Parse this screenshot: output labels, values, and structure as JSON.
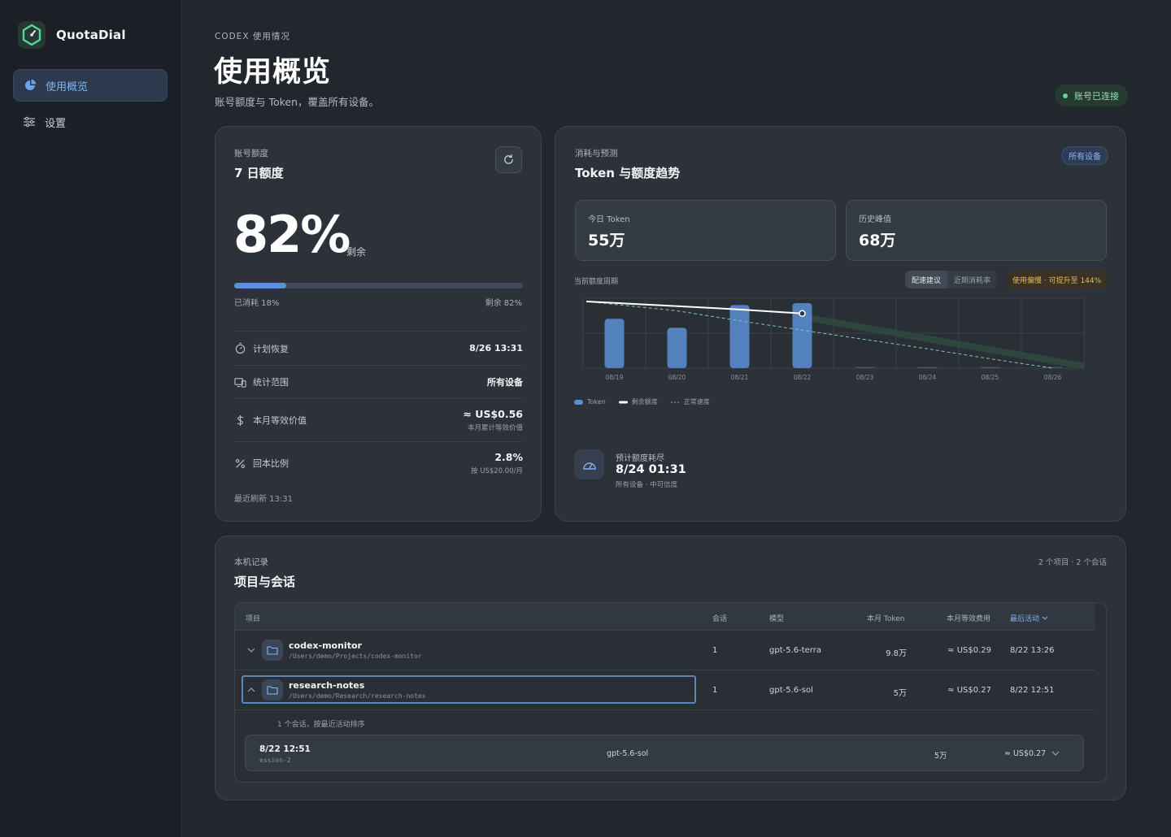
{
  "brand": {
    "name": "QuotaDial"
  },
  "sidebar": {
    "items": [
      {
        "label": "使用概览",
        "icon": "pie-chart-icon",
        "active": true
      },
      {
        "label": "设置",
        "icon": "sliders-icon",
        "active": false
      }
    ]
  },
  "header": {
    "eyebrow": "CODEX 使用情况",
    "title": "使用概览",
    "subtitle": "账号额度与 Token，覆盖所有设备。",
    "status_badge": "账号已连接"
  },
  "quota": {
    "eyebrow": "账号额度",
    "title": "7 日额度",
    "remaining_pct": "82%",
    "remaining_suffix": "剩余",
    "consumed_fraction": 0.18,
    "consumed_label": "已消耗 18%",
    "remaining_label": "剩余 82%",
    "rows": [
      {
        "icon": "timer-icon",
        "label": "计划恢复",
        "value": "8/26 13:31",
        "sub": ""
      },
      {
        "icon": "devices-icon",
        "label": "统计范围",
        "value": "所有设备",
        "sub": ""
      },
      {
        "icon": "dollar-icon",
        "label": "本月等效价值",
        "value": "≈ US$0.56",
        "sub": "本月累计等效价值"
      },
      {
        "icon": "percent-icon",
        "label": "回本比例",
        "value": "2.8%",
        "sub": "按 US$20.00/月"
      }
    ],
    "last_refresh": "最近刷新 13:31"
  },
  "trend": {
    "eyebrow": "消耗与预测",
    "title": "Token 与额度趋势",
    "device_pill": "所有设备",
    "today_label": "今日 Token",
    "today_value": "55万",
    "peak_label": "历史峰值",
    "peak_value": "68万",
    "period_label": "当前额度周期",
    "seg_options": [
      "配速建议",
      "近期消耗率"
    ],
    "warn": "使用偏慢 · 可提升至 144%",
    "legend": [
      "Token",
      "剩余额度",
      "正常速度"
    ],
    "forecast_label": "预计额度耗尽",
    "forecast_value": "8/24 01:31",
    "forecast_sub": "所有设备 · 中可信度"
  },
  "chart_data": {
    "type": "bar",
    "categories": [
      "08/19",
      "08/20",
      "08/21",
      "08/22",
      "08/23",
      "08/24",
      "08/25",
      "08/26"
    ],
    "series": [
      {
        "name": "Token",
        "values": [
          0.76,
          0.62,
          0.97,
          1.0,
          0,
          0,
          0,
          0
        ]
      },
      {
        "name": "剩余额度",
        "values": [
          1.0,
          0.93,
          0.88,
          0.82
        ]
      },
      {
        "name": "正常速度",
        "values": [
          1.0,
          0.86,
          0.71,
          0.57,
          0.43,
          0.29,
          0.14,
          0.0
        ]
      }
    ],
    "grid": true,
    "legend": "bottom-left"
  },
  "projects": {
    "eyebrow": "本机记录",
    "title": "项目与会话",
    "meta": "2 个项目 · 2 个会话",
    "columns": [
      "项目",
      "会话",
      "模型",
      "本月 Token",
      "本月等效费用",
      "最后活动"
    ],
    "rows": [
      {
        "name": "codex-monitor",
        "path": "/Users/demo/Projects/codex-monitor",
        "sessions": "1",
        "model": "gpt-5.6-terra",
        "tokens": "9.8万",
        "cost": "≈ US$0.29",
        "last": "8/22 13:26",
        "expanded": false
      },
      {
        "name": "research-notes",
        "path": "/Users/demo/Research/research-notes",
        "sessions": "1",
        "model": "gpt-5.6-sol",
        "tokens": "5万",
        "cost": "≈ US$0.27",
        "last": "8/22 12:51",
        "expanded": true
      }
    ],
    "sub_note": "1 个会话，按最近活动排序",
    "session": {
      "time": "8/22 12:51",
      "id": "ession-2",
      "model": "gpt-5.6-sol",
      "tokens": "5万",
      "cost": "≈ US$0.27"
    }
  },
  "colors": {
    "accent": "#5b8fd6",
    "success": "#5fd39a",
    "warning": "#e6b95a",
    "background": "#22262d",
    "card": "#2d323a"
  }
}
